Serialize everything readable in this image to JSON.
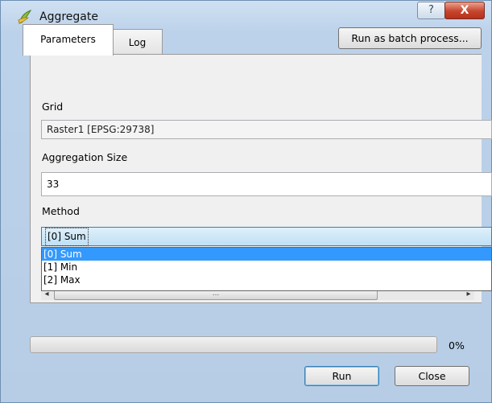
{
  "window": {
    "title": "Aggregate",
    "help_glyph": "?",
    "close_glyph": "X"
  },
  "tabs": [
    {
      "label": "Parameters",
      "active": true
    },
    {
      "label": "Log",
      "active": false
    }
  ],
  "toolbar": {
    "batch_label": "Run as batch process..."
  },
  "params": {
    "grid": {
      "label": "Grid",
      "value": "Raster1 [EPSG:29738]"
    },
    "aggregation_size": {
      "label": "Aggregation Size",
      "value": "33"
    },
    "method": {
      "label": "Method",
      "selected": "[0] Sum",
      "options": [
        "[0] Sum",
        "[1] Min",
        "[2] Max"
      ],
      "highlighted_index": 0
    }
  },
  "progress": {
    "value_pct": 0,
    "label": "0%"
  },
  "buttons": {
    "run": "Run",
    "close": "Close"
  },
  "icons": {
    "app": "qgis-logo-icon",
    "scroll_left": "arrow-left-icon",
    "scroll_right": "arrow-right-icon"
  },
  "colors": {
    "selection": "#3399ff",
    "title_bg": "#bcd2ea",
    "close_red": "#c7442d"
  }
}
